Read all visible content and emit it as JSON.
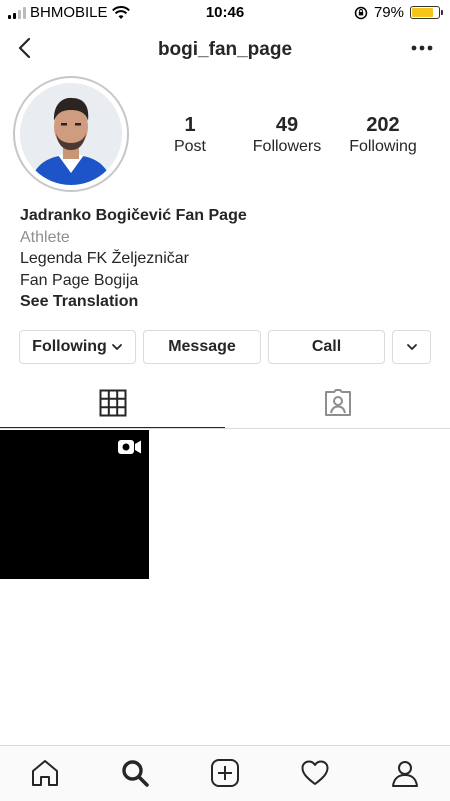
{
  "status_bar": {
    "carrier": "BHMOBILE",
    "time": "10:46",
    "battery": "79%"
  },
  "header": {
    "username": "bogi_fan_page"
  },
  "stats": [
    {
      "value": "1",
      "label": "Post"
    },
    {
      "value": "49",
      "label": "Followers"
    },
    {
      "value": "202",
      "label": "Following"
    }
  ],
  "bio": {
    "name": "Jadranko Bogičević Fan Page",
    "category": "Athlete",
    "line1": "Legenda FK Željezničar",
    "line2": "Fan Page Bogija",
    "translate": "See Translation"
  },
  "actions": {
    "following": "Following",
    "message": "Message",
    "call": "Call"
  },
  "icons": [
    "back-arrow-icon",
    "more-dots-icon",
    "grid-icon",
    "tagged-icon",
    "video-icon",
    "home-icon",
    "search-icon",
    "add-icon",
    "heart-icon",
    "profile-icon"
  ]
}
